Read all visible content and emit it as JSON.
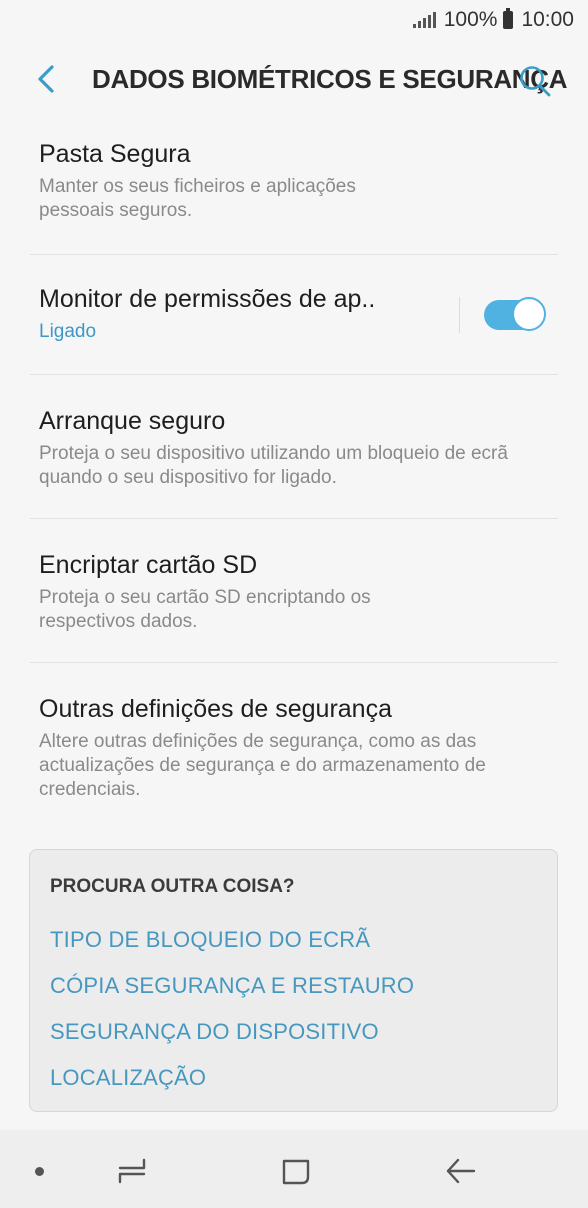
{
  "status_bar": {
    "battery": "100%",
    "time": "10:00"
  },
  "app_bar": {
    "title": "DADOS BIOMÉTRICOS E SEGURANÇA"
  },
  "items": [
    {
      "title": "Pasta Segura",
      "subtitle": "Manter os seus ficheiros e aplicações pessoais seguros."
    },
    {
      "title": "Monitor de permissões de ap..",
      "subtitle": "Ligado",
      "toggle": true
    },
    {
      "title": "Arranque seguro",
      "subtitle": "Proteja o seu dispositivo utilizando um bloqueio de ecrã quando o seu dispositivo for ligado."
    },
    {
      "title": "Encriptar cartão SD",
      "subtitle": "Proteja o seu cartão SD encriptando os respectivos dados."
    },
    {
      "title": "Outras definições de segurança",
      "subtitle": "Altere outras definições de segurança, como as das actualizações de segurança e do armazenamento de credenciais."
    }
  ],
  "suggestions": {
    "header": "PROCURA OUTRA COISA?",
    "links": [
      "TIPO DE BLOQUEIO DO ECRÃ",
      "CÓPIA SEGURANÇA E RESTAURO",
      "SEGURANÇA DO DISPOSITIVO",
      "LOCALIZAÇÃO"
    ]
  },
  "colors": {
    "accent": "#4fb2e0",
    "link": "#4798bf",
    "background": "#f6f6f6"
  }
}
